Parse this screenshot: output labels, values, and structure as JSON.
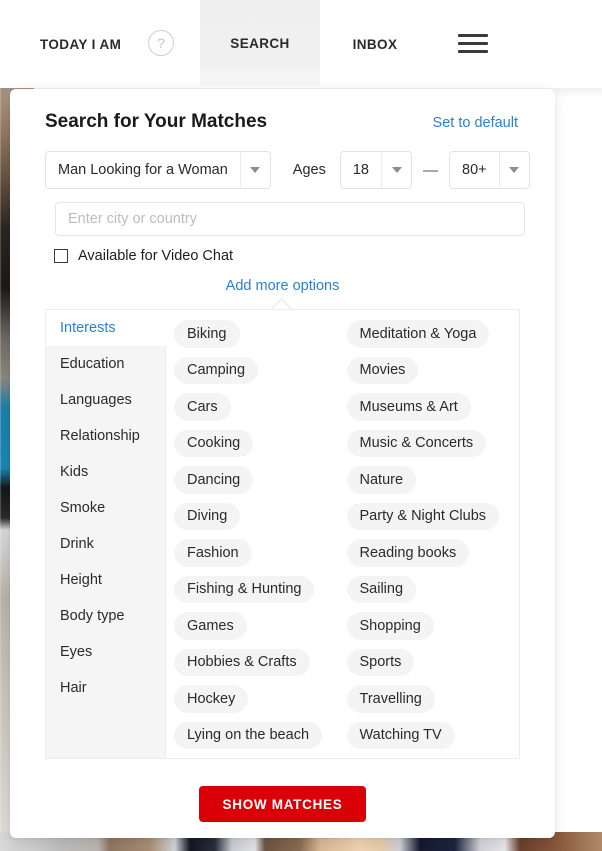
{
  "topnav": {
    "items": [
      {
        "id": "today-i-am",
        "label": "TODAY I AM",
        "active": false
      },
      {
        "id": "search",
        "label": "SEARCH",
        "active": true
      },
      {
        "id": "inbox",
        "label": "INBOX",
        "active": false
      }
    ],
    "help_icon": "?",
    "menu_icon": "hamburger-icon"
  },
  "panel": {
    "title": "Search for Your Matches",
    "set_to_default": "Set to default",
    "criteria": {
      "looking_for": {
        "value": "Man Looking for a Woman",
        "options": [
          "Man Looking for a Woman"
        ]
      },
      "ages_label": "Ages",
      "age_from": {
        "value": "18",
        "options": [
          "18"
        ]
      },
      "age_dash": "—",
      "age_to": {
        "value": "80+",
        "options": [
          "80+"
        ]
      }
    },
    "location": {
      "value": "",
      "placeholder": "Enter city or country"
    },
    "video_chat": {
      "label": "Available for Video Chat",
      "checked": false
    },
    "add_more_options": "Add more options",
    "show_matches": "SHOW MATCHES"
  },
  "interests": {
    "categories": [
      {
        "label": "Interests",
        "active": true
      },
      {
        "label": "Education",
        "active": false
      },
      {
        "label": "Languages",
        "active": false
      },
      {
        "label": "Relationship",
        "active": false
      },
      {
        "label": "Kids",
        "active": false
      },
      {
        "label": "Smoke",
        "active": false
      },
      {
        "label": "Drink",
        "active": false
      },
      {
        "label": "Height",
        "active": false
      },
      {
        "label": "Body type",
        "active": false
      },
      {
        "label": "Eyes",
        "active": false
      },
      {
        "label": "Hair",
        "active": false
      }
    ],
    "column_left": [
      "Biking",
      "Camping",
      "Cars",
      "Cooking",
      "Dancing",
      "Diving",
      "Fashion",
      "Fishing & Hunting",
      "Games",
      "Hobbies & Crafts",
      "Hockey",
      "Lying on the beach"
    ],
    "column_right": [
      "Meditation & Yoga",
      "Movies",
      "Museums & Art",
      "Music & Concerts",
      "Nature",
      "Party & Night Clubs",
      "Reading books",
      "Sailing",
      "Shopping",
      "Sports",
      "Travelling",
      "Watching TV"
    ]
  },
  "colors": {
    "link": "#2b7fd4",
    "primary_button": "#d90008",
    "chip_background": "#f4f4f4",
    "tab_background": "#f5f5f5"
  }
}
